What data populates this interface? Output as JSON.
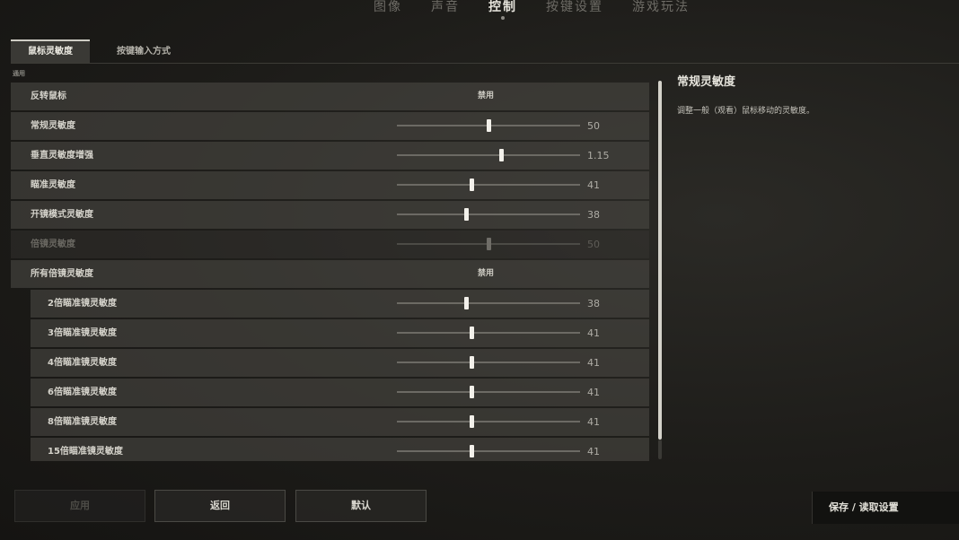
{
  "nav": {
    "tabs": [
      {
        "label": "图像"
      },
      {
        "label": "声音"
      },
      {
        "label": "控制"
      },
      {
        "label": "按键设置"
      },
      {
        "label": "游戏玩法"
      }
    ]
  },
  "subtabs": [
    {
      "label": "鼠标灵敏度"
    },
    {
      "label": "按键输入方式"
    }
  ],
  "section": {
    "label": "通用"
  },
  "rows": [
    {
      "label": "反转鼠标",
      "value": "禁用"
    },
    {
      "label": "常规灵敏度",
      "value": "50"
    },
    {
      "label": "垂直灵敏度增强",
      "value": "1.15"
    },
    {
      "label": "瞄准灵敏度",
      "value": "41"
    },
    {
      "label": "开镜模式灵敏度",
      "value": "38"
    },
    {
      "label": "倍镜灵敏度",
      "value": "50"
    },
    {
      "label": "所有倍镜灵敏度",
      "value": "禁用"
    },
    {
      "label": "2倍瞄准镜灵敏度",
      "value": "38"
    },
    {
      "label": "3倍瞄准镜灵敏度",
      "value": "41"
    },
    {
      "label": "4倍瞄准镜灵敏度",
      "value": "41"
    },
    {
      "label": "6倍瞄准镜灵敏度",
      "value": "41"
    },
    {
      "label": "8倍瞄准镜灵敏度",
      "value": "41"
    },
    {
      "label": "15倍瞄准镜灵敏度",
      "value": "41"
    }
  ],
  "help": {
    "title": "常规灵敏度",
    "text": "调整一般（观看）鼠标移动的灵敏度。"
  },
  "buttons": {
    "apply": "应用",
    "back": "返回",
    "default": "默认",
    "save_load": "保存 / 读取设置"
  }
}
